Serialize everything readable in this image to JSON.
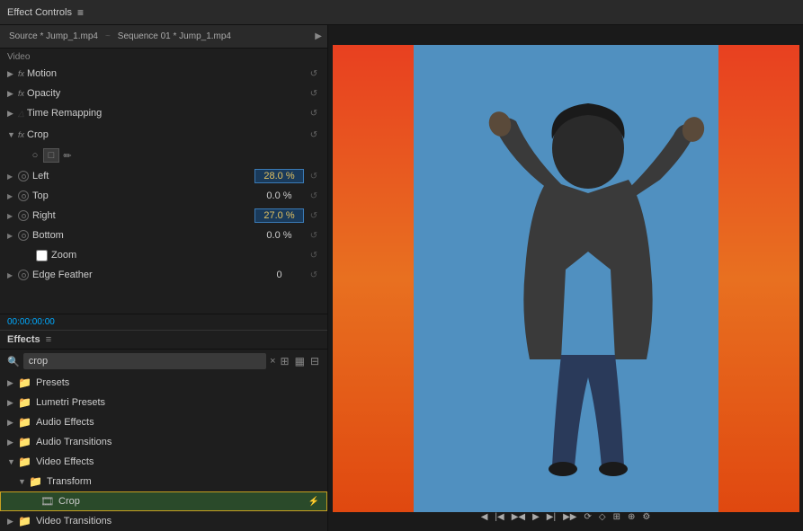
{
  "header": {
    "title": "Effect Controls",
    "menu_icon": "≡"
  },
  "source_tabs": {
    "tab1": "Source * Jump_1.mp4",
    "separator": "~",
    "tab2": "Sequence 01 * Jump_1.mp4",
    "arrow": "▶"
  },
  "effect_controls": {
    "section_label": "Video",
    "fx_items": [
      {
        "name": "Motion",
        "badge": "fx",
        "reset": "↺"
      },
      {
        "name": "Opacity",
        "badge": "fx",
        "reset": "↺"
      },
      {
        "name": "Time Remapping",
        "badge": "",
        "reset": "↺"
      }
    ],
    "crop": {
      "name": "Crop",
      "badge": "fx",
      "reset": "↺",
      "icons": [
        "○",
        "□",
        "✏"
      ],
      "params": [
        {
          "name": "Left",
          "value": "28.0 %",
          "highlighted": true,
          "reset": "↺"
        },
        {
          "name": "Top",
          "value": "0.0 %",
          "highlighted": false,
          "reset": "↺"
        },
        {
          "name": "Right",
          "value": "27.0 %",
          "highlighted": true,
          "reset": "↺"
        },
        {
          "name": "Bottom",
          "value": "0.0 %",
          "highlighted": false,
          "reset": "↺"
        }
      ],
      "zoom_label": "Zoom",
      "edge_feather": {
        "name": "Edge Feather",
        "value": "0",
        "reset": "↺"
      }
    }
  },
  "timecode": "00:00:00:00",
  "effects_panel": {
    "title": "Effects",
    "menu_icon": "≡",
    "search": {
      "placeholder": "crop",
      "value": "crop",
      "clear_icon": "×",
      "icon1": "⊞",
      "icon2": "▦",
      "icon3": "⊟"
    },
    "tree_items": [
      {
        "type": "folder",
        "name": "Presets",
        "color": "yellow",
        "indent": 0,
        "collapsed": true
      },
      {
        "type": "folder",
        "name": "Lumetri Presets",
        "color": "yellow",
        "indent": 0,
        "collapsed": true
      },
      {
        "type": "folder",
        "name": "Audio Effects",
        "color": "blue",
        "indent": 0,
        "collapsed": true
      },
      {
        "type": "folder",
        "name": "Audio Transitions",
        "color": "blue",
        "indent": 0,
        "collapsed": true
      },
      {
        "type": "folder",
        "name": "Video Effects",
        "color": "blue",
        "indent": 0,
        "collapsed": false
      },
      {
        "type": "folder",
        "name": "Transform",
        "color": "blue",
        "indent": 1,
        "collapsed": false
      },
      {
        "type": "file",
        "name": "Crop",
        "indent": 2,
        "selected": true
      },
      {
        "type": "folder",
        "name": "Video Transitions",
        "color": "blue",
        "indent": 0,
        "collapsed": true
      }
    ]
  },
  "preview_controls": {
    "buttons": [
      "◀◀",
      "◀",
      "▶◀",
      "▶",
      "▶▶",
      "⦾",
      "⦾",
      "⟳",
      "⟳",
      "⟳",
      "⊕"
    ]
  }
}
